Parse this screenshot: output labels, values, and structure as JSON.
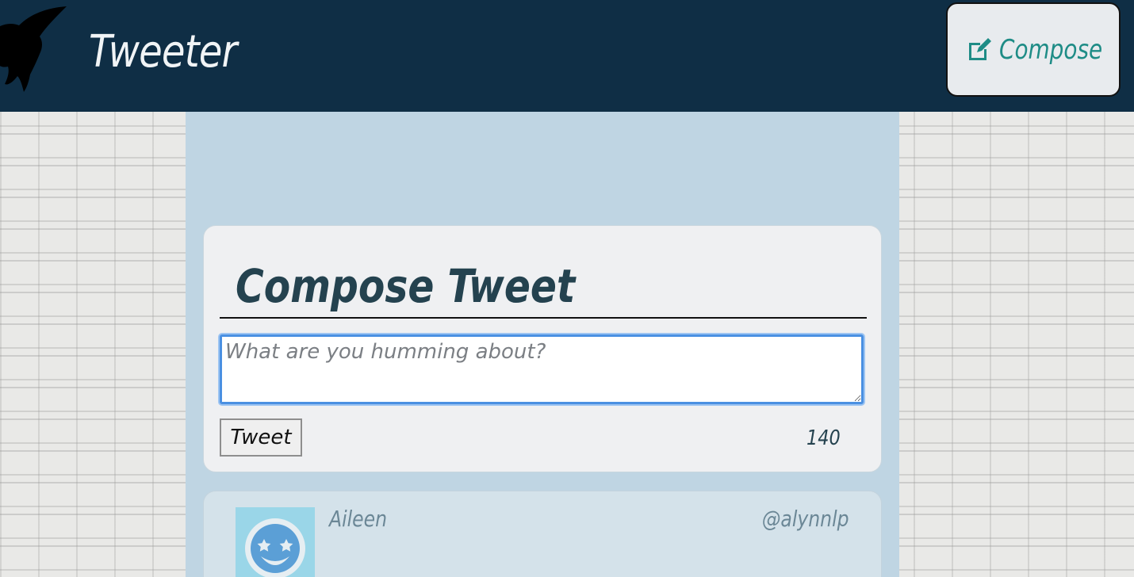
{
  "nav": {
    "brand": "Tweeter",
    "compose_label": "Compose",
    "bird_icon": "hummingbird-silhouette",
    "compose_icon": "edit-icon"
  },
  "compose": {
    "title": "Compose Tweet",
    "placeholder": "What are you humming about?",
    "submit_label": "Tweet",
    "counter": "140"
  },
  "tweets": [
    {
      "name": "Aileen",
      "handle": "@alynnlp",
      "avatar_icon": "smiley-star-eyes"
    }
  ],
  "colors": {
    "nav_bg": "#0f2e45",
    "column_bg": "#bfd5e3",
    "accent": "#1e8c86",
    "title": "#24424f"
  }
}
